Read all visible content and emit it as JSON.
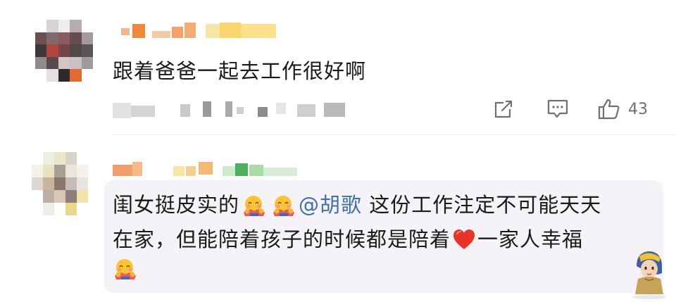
{
  "comment1": {
    "text": "跟着爸爸一起去工作很好啊",
    "likes": "43"
  },
  "comment2": {
    "line1_a": "闺女挺皮实的",
    "mention": "@胡歌",
    "line1_b": " 这份工作注定不可能天天",
    "line2_a": "在家，但能陪着孩子的时候都是陪着",
    "line2_b": "一家人幸福"
  },
  "icons": {
    "repost": "share-icon",
    "reply": "comment-icon",
    "like": "thumbs-up-icon",
    "emoji": "hugging-face-emoji",
    "heart": "red-heart-emoji",
    "sticker": "girl-with-pearl-earring-sticker"
  },
  "colors": {
    "mention": "#3e6fb2",
    "bubble": "#f5f3f7",
    "meta": "#707070"
  }
}
